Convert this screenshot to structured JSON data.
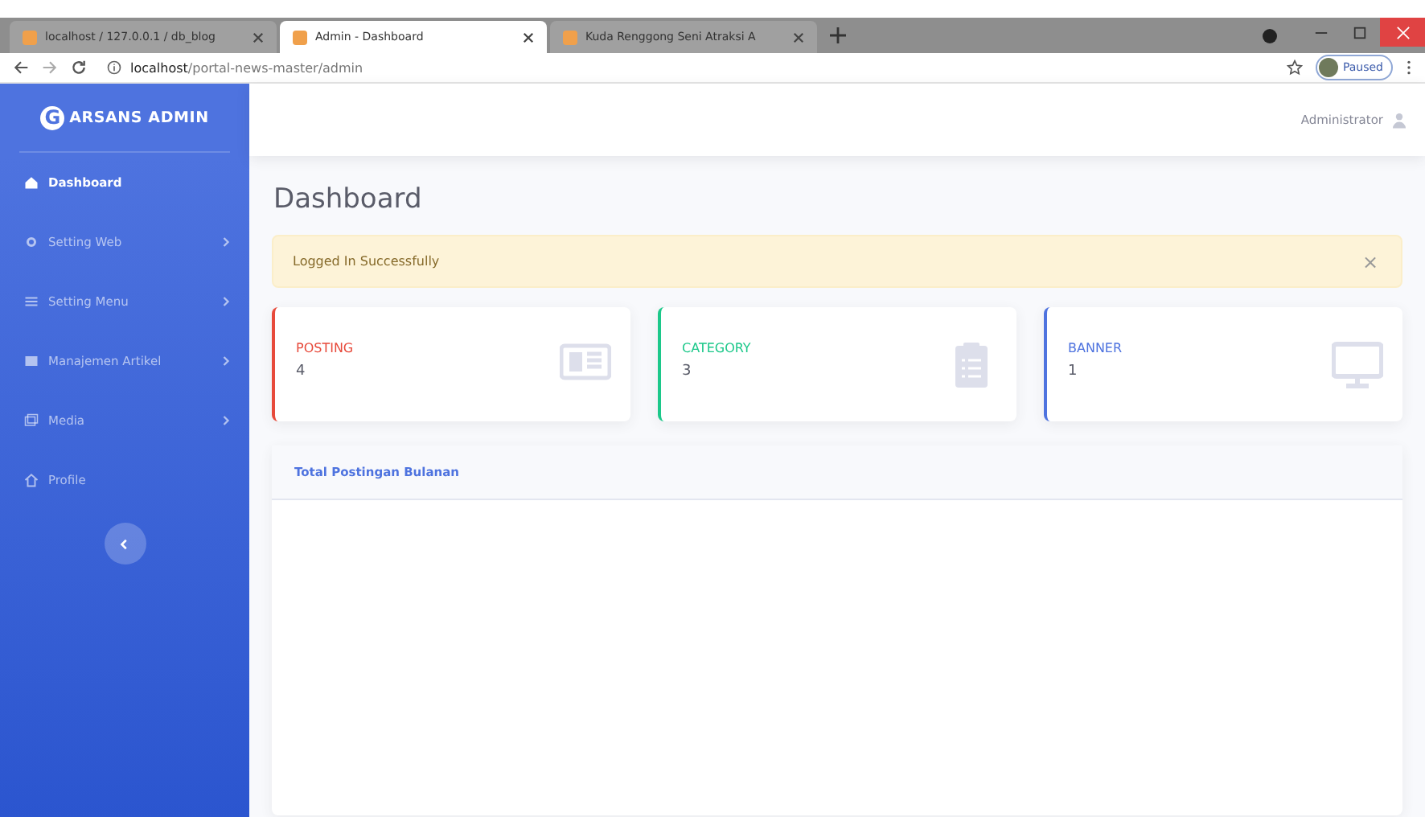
{
  "browser": {
    "tabs": [
      {
        "title": "localhost / 127.0.0.1 / db_blog",
        "selected": false
      },
      {
        "title": "Admin - Dashboard",
        "selected": true
      },
      {
        "title": "Kuda Renggong Seni Atraksi A",
        "selected": false
      }
    ],
    "url_host": "localhost",
    "url_path": "/portal-news-master/admin",
    "profile_label": "Paused"
  },
  "sidebar": {
    "brand_letter": "G",
    "brand": "ARSANS ADMIN",
    "items": [
      {
        "label": "Dashboard",
        "selected": true,
        "has_submenu": false
      },
      {
        "label": "Setting Web",
        "selected": false,
        "has_submenu": true
      },
      {
        "label": "Setting Menu",
        "selected": false,
        "has_submenu": true
      },
      {
        "label": "Manajemen Artikel",
        "selected": false,
        "has_submenu": true
      },
      {
        "label": "Media",
        "selected": false,
        "has_submenu": true
      },
      {
        "label": "Profile",
        "selected": false,
        "has_submenu": false
      }
    ]
  },
  "topbar": {
    "user": "Administrator"
  },
  "page_title": "Dashboard",
  "alert": {
    "message": "Logged In Successfully",
    "close": "×"
  },
  "cards": [
    {
      "label": "POSTING",
      "value": "4",
      "color": "#e74a3b"
    },
    {
      "label": "CATEGORY",
      "value": "3",
      "color": "#1cc88a"
    },
    {
      "label": "BANNER",
      "value": "1",
      "color": "#4e73df"
    }
  ],
  "chart_card": {
    "title": "Total Postingan Bulanan"
  }
}
